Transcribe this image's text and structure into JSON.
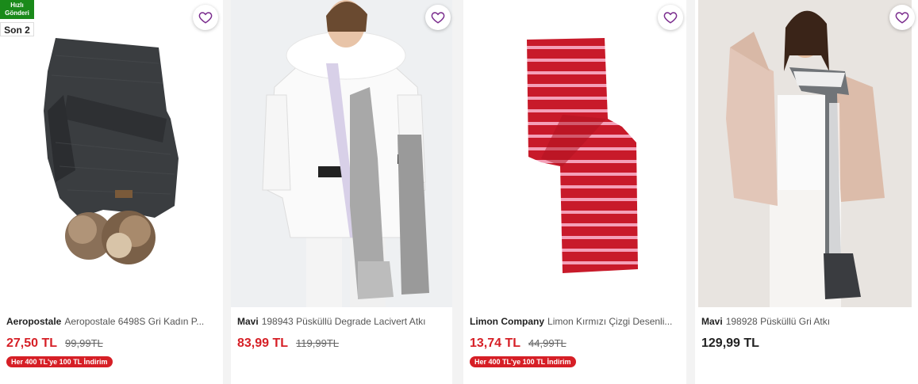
{
  "products": [
    {
      "brand": "Aeropostale",
      "name": "Aeropostale 6498S Gri Kadın P...",
      "price": "27,50 TL",
      "old_price": "99,99TL",
      "promo": "Her 400 TL'ye 100 TL İndirim",
      "badge_fast": "Hızlı Gönderi",
      "badge_stock": "Son 2",
      "image": "charcoal knit scarf with fur pompoms"
    },
    {
      "brand": "Mavi",
      "name": "198943 Püsküllü Degrade Lacivert Atkı",
      "price": "83,99 TL",
      "old_price": "119,99TL",
      "promo": "",
      "image": "woman in white jacket with grey scarf"
    },
    {
      "brand": "Limon Company",
      "name": "Limon Kırmızı Çizgi Desenli...",
      "price": "13,74 TL",
      "old_price": "44,99TL",
      "promo": "Her 400 TL'ye 100 TL İndirim",
      "image": "red scarf with pink stripes"
    },
    {
      "brand": "Mavi",
      "name": "198928 Püsküllü Gri Atkı",
      "price": "129,99 TL",
      "old_price": "",
      "promo": "",
      "image": "woman in pink cardigan with grey tassel scarf"
    }
  ],
  "favorite_icon": "heart-icon",
  "colors": {
    "price": "#d61f26",
    "promo_bg": "#d61f26",
    "fast_badge": "#1a8a1a",
    "heart": "#7b2d8e"
  }
}
